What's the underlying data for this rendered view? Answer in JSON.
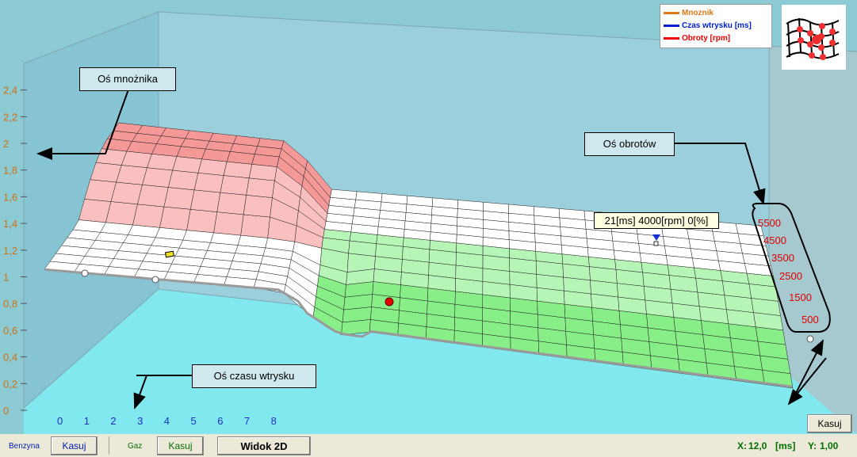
{
  "colors": {
    "mnoznik": "#e07818",
    "czas": "#0020d0",
    "obroty": "#f00000",
    "z_axis_text": "#d07010",
    "x_axis_text": "#2030c0",
    "rpm_text": "#e00000",
    "status_green": "#007000"
  },
  "legend": {
    "items": [
      {
        "label": "Mnoznik",
        "color": "#e07818"
      },
      {
        "label": "Czas wtrysku [ms]",
        "color": "#0020d0"
      },
      {
        "label": "Obroty [rpm]",
        "color": "#f00000"
      }
    ]
  },
  "callouts": {
    "multiplier_axis": "Oś mnożnika",
    "rpm_axis": "Oś obrotów",
    "time_axis": "Oś czasu wtrysku"
  },
  "tooltip": "21[ms] 4000[rpm] 0[%]",
  "z_ticks": [
    "0",
    "0,2",
    "0,4",
    "0,6",
    "0,8",
    "1",
    "1,2",
    "1,4",
    "1,6",
    "1,8",
    "2",
    "2,2",
    "2,4"
  ],
  "x_ticks": [
    "0",
    "1",
    "2",
    "3",
    "4",
    "5",
    "6",
    "7",
    "8"
  ],
  "rpm_ticks": [
    "5500",
    "4500",
    "3500",
    "2500",
    "1500",
    "500"
  ],
  "buttons": {
    "kasuj_right": "Kasuj",
    "kasuj_benzyna": "Kasuj",
    "kasuj_gaz": "Kasuj",
    "widok2d": "Widok 2D"
  },
  "status": {
    "benzyna_label": "Benzyna",
    "gaz_label": "Gaz",
    "x_label": "X:",
    "x_value": "12,0",
    "x_unit": "[ms]",
    "y_label": "Y:",
    "y_value": "1,00"
  }
}
